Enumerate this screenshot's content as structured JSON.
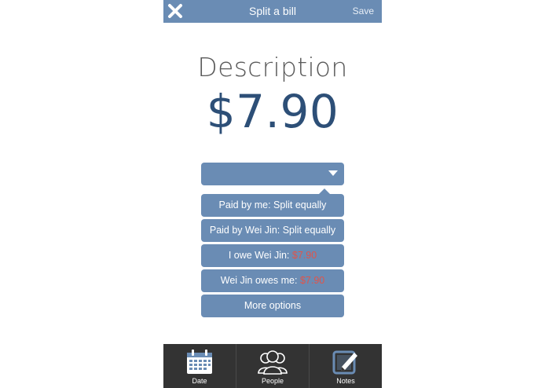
{
  "header": {
    "title": "Split a bill",
    "save_label": "Save",
    "close_icon": "close-icon"
  },
  "bill": {
    "description": "Description",
    "amount": "$7.90"
  },
  "dropdown": {
    "selected": ""
  },
  "options": [
    {
      "text": "Paid by me: Split equally",
      "amount": ""
    },
    {
      "text": "Paid by Wei Jin: Split equally",
      "amount": ""
    },
    {
      "text": "I owe Wei Jin: ",
      "amount": "$7.90"
    },
    {
      "text": "Wei Jin owes me: ",
      "amount": "$7.90"
    },
    {
      "text": "More options",
      "amount": ""
    }
  ],
  "tabs": [
    {
      "label": "Date",
      "icon": "calendar-icon"
    },
    {
      "label": "People",
      "icon": "people-icon"
    },
    {
      "label": "Notes",
      "icon": "notes-icon"
    }
  ],
  "colors": {
    "accent": "#6a8cb4",
    "amount_text": "#2d4f77",
    "negative": "#e0544b",
    "tabbar": "#333333"
  }
}
